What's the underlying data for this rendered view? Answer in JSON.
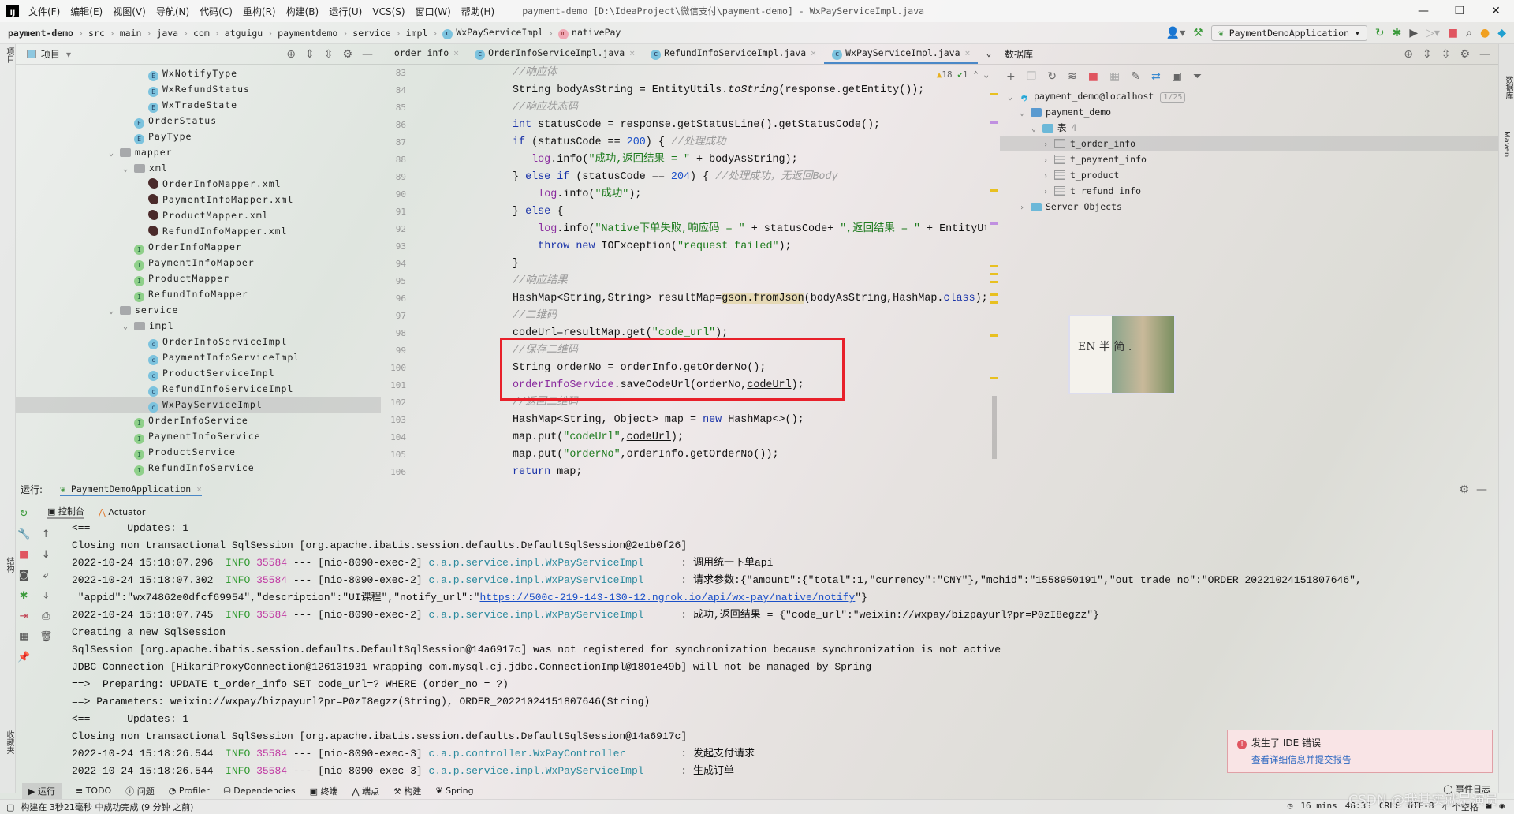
{
  "app": {
    "logo": "IJ",
    "menu": [
      "文件(F)",
      "编辑(E)",
      "视图(V)",
      "导航(N)",
      "代码(C)",
      "重构(R)",
      "构建(B)",
      "运行(U)",
      "VCS(S)",
      "窗口(W)",
      "帮助(H)"
    ],
    "title": "payment-demo [D:\\IdeaProject\\微信支付\\payment-demo] - WxPayServiceImpl.java",
    "window_controls": [
      "—",
      "❐",
      "✕"
    ]
  },
  "breadcrumb": [
    "payment-demo",
    "src",
    "main",
    "java",
    "com",
    "atguigu",
    "paymentdemo",
    "service",
    "impl",
    "WxPayServiceImpl",
    "nativePay"
  ],
  "toolbar": {
    "run_config": "PaymentDemoApplication",
    "icons": [
      "user-icon",
      "build-hammer-icon",
      "rerun-icon",
      "debug-icon",
      "coverage-icon",
      "profile-icon",
      "stop-icon",
      "search-icon",
      "update-icon",
      "jetbrains-icon"
    ]
  },
  "accent": {
    "highlight_box": "#e8202a",
    "stop": "#e05560",
    "link": "#1a4fc8"
  },
  "left_strip": {
    "project": "项目",
    "structure": "结构",
    "favorites": "收藏夹"
  },
  "right_strip": {
    "database": "数据库",
    "maven": "Maven"
  },
  "project": {
    "title": "项目",
    "tree": [
      {
        "label": "WxNotifyType",
        "icon": "E",
        "depth": 4
      },
      {
        "label": "WxRefundStatus",
        "icon": "E",
        "depth": 4
      },
      {
        "label": "WxTradeState",
        "icon": "E",
        "depth": 4
      },
      {
        "label": "OrderStatus",
        "icon": "E",
        "depth": 3
      },
      {
        "label": "PayType",
        "icon": "E",
        "depth": 3
      },
      {
        "label": "mapper",
        "icon": "F",
        "depth": 2,
        "expanded": true
      },
      {
        "label": "xml",
        "icon": "F",
        "depth": 3,
        "expanded": true
      },
      {
        "label": "OrderInfoMapper.xml",
        "icon": "X",
        "depth": 4
      },
      {
        "label": "PaymentInfoMapper.xml",
        "icon": "X",
        "depth": 4
      },
      {
        "label": "ProductMapper.xml",
        "icon": "X",
        "depth": 4
      },
      {
        "label": "RefundInfoMapper.xml",
        "icon": "X",
        "depth": 4
      },
      {
        "label": "OrderInfoMapper",
        "icon": "I",
        "depth": 3
      },
      {
        "label": "PaymentInfoMapper",
        "icon": "I",
        "depth": 3
      },
      {
        "label": "ProductMapper",
        "icon": "I",
        "depth": 3
      },
      {
        "label": "RefundInfoMapper",
        "icon": "I",
        "depth": 3
      },
      {
        "label": "service",
        "icon": "F",
        "depth": 2,
        "expanded": true
      },
      {
        "label": "impl",
        "icon": "F",
        "depth": 3,
        "expanded": true
      },
      {
        "label": "OrderInfoServiceImpl",
        "icon": "C",
        "depth": 4
      },
      {
        "label": "PaymentInfoServiceImpl",
        "icon": "C",
        "depth": 4
      },
      {
        "label": "ProductServiceImpl",
        "icon": "C",
        "depth": 4
      },
      {
        "label": "RefundInfoServiceImpl",
        "icon": "C",
        "depth": 4
      },
      {
        "label": "WxPayServiceImpl",
        "icon": "C",
        "depth": 4,
        "selected": true
      },
      {
        "label": "OrderInfoService",
        "icon": "I",
        "depth": 3
      },
      {
        "label": "PaymentInfoService",
        "icon": "I",
        "depth": 3
      },
      {
        "label": "ProductService",
        "icon": "I",
        "depth": 3
      },
      {
        "label": "RefundInfoService",
        "icon": "I",
        "depth": 3
      }
    ]
  },
  "editor": {
    "tabs": [
      {
        "label": "_order_info",
        "icon": ""
      },
      {
        "label": "OrderInfoServiceImpl.java",
        "icon": "C"
      },
      {
        "label": "RefundInfoServiceImpl.java",
        "icon": "C"
      },
      {
        "label": "WxPayServiceImpl.java",
        "icon": "C",
        "active": true
      }
    ],
    "inspections": {
      "warnings": "18",
      "ok": "1"
    },
    "lines": [
      {
        "n": "83",
        "t": [
          [
            "//响应体",
            "c"
          ]
        ]
      },
      {
        "n": "84",
        "t": [
          [
            "String bodyAsString = EntityUtils.",
            ""
          ],
          [
            "toString",
            "m"
          ],
          [
            "(response.getEntity());",
            ""
          ]
        ]
      },
      {
        "n": "85",
        "t": [
          [
            "//响应状态码",
            "c"
          ]
        ]
      },
      {
        "n": "86",
        "t": [
          [
            "int",
            "k"
          ],
          [
            " statusCode = response.getStatusLine().getStatusCode();",
            ""
          ]
        ]
      },
      {
        "n": "87",
        "t": [
          [
            "if",
            "k"
          ],
          [
            " (statusCode == ",
            ""
          ],
          [
            "200",
            "n"
          ],
          [
            ") { ",
            ""
          ],
          [
            "//处理成功",
            "c"
          ]
        ]
      },
      {
        "n": "88",
        "t": [
          [
            "   ",
            ""
          ],
          [
            "log",
            "f"
          ],
          [
            ".info(",
            ""
          ],
          [
            "\"成功,返回结果 = \"",
            "s"
          ],
          [
            " + bodyAsString);",
            ""
          ]
        ]
      },
      {
        "n": "89",
        "t": [
          [
            "} ",
            ""
          ],
          [
            "else if",
            "k"
          ],
          [
            " (statusCode == ",
            ""
          ],
          [
            "204",
            "n"
          ],
          [
            ") { ",
            ""
          ],
          [
            "//处理成功，无返回Body",
            "c"
          ]
        ]
      },
      {
        "n": "90",
        "t": [
          [
            "    ",
            ""
          ],
          [
            "log",
            "f"
          ],
          [
            ".info(",
            ""
          ],
          [
            "\"成功\"",
            "s"
          ],
          [
            ");",
            ""
          ]
        ]
      },
      {
        "n": "91",
        "t": [
          [
            "} ",
            ""
          ],
          [
            "else",
            "k"
          ],
          [
            " {",
            ""
          ]
        ]
      },
      {
        "n": "92",
        "t": [
          [
            "    ",
            ""
          ],
          [
            "log",
            "f"
          ],
          [
            ".info(",
            ""
          ],
          [
            "\"Native下单失败,响应码 = \"",
            "s"
          ],
          [
            " + statusCode+ ",
            ""
          ],
          [
            "\",返回结果 = \"",
            "s"
          ],
          [
            " + EntityUtil",
            ""
          ]
        ]
      },
      {
        "n": "93",
        "t": [
          [
            "    ",
            ""
          ],
          [
            "throw new",
            "k"
          ],
          [
            " IOException(",
            ""
          ],
          [
            "\"request failed\"",
            "s"
          ],
          [
            ");",
            ""
          ]
        ]
      },
      {
        "n": "94",
        "t": [
          [
            "}",
            ""
          ]
        ]
      },
      {
        "n": "95",
        "t": [
          [
            "//响应结果",
            "c"
          ]
        ]
      },
      {
        "n": "96",
        "t": [
          [
            "HashMap<String,String> resultMap=",
            ""
          ],
          [
            "gson.fromJson",
            "h"
          ],
          [
            "(bodyAsString,HashMap.",
            ""
          ],
          [
            "class",
            "k"
          ],
          [
            ");",
            ""
          ]
        ]
      },
      {
        "n": "97",
        "t": [
          [
            "//二维码",
            "c"
          ]
        ]
      },
      {
        "n": "98",
        "t": [
          [
            "codeUrl=resultMap.get(",
            ""
          ],
          [
            "\"code_url\"",
            "s"
          ],
          [
            ");",
            ""
          ]
        ]
      },
      {
        "n": "99",
        "t": [
          [
            "//保存二维码",
            "c"
          ]
        ]
      },
      {
        "n": "100",
        "t": [
          [
            "String orderNo = orderInfo.getOrderNo();",
            ""
          ]
        ]
      },
      {
        "n": "101",
        "t": [
          [
            "orderInfoService",
            "f"
          ],
          [
            ".saveCodeUrl(orderNo,",
            ""
          ],
          [
            "codeUrl",
            "u"
          ],
          [
            ");",
            ""
          ]
        ]
      },
      {
        "n": "102",
        "t": [
          [
            "//返回二维码",
            "c"
          ]
        ]
      },
      {
        "n": "103",
        "t": [
          [
            "HashMap<String, Object> map = ",
            ""
          ],
          [
            "new",
            "k"
          ],
          [
            " HashMap<>();",
            ""
          ]
        ]
      },
      {
        "n": "104",
        "t": [
          [
            "map.put(",
            ""
          ],
          [
            "\"codeUrl\"",
            "s"
          ],
          [
            ",",
            ""
          ],
          [
            "codeUrl",
            "u"
          ],
          [
            ");",
            ""
          ]
        ]
      },
      {
        "n": "105",
        "t": [
          [
            "map.put(",
            ""
          ],
          [
            "\"orderNo\"",
            "s"
          ],
          [
            ",orderInfo.getOrderNo());",
            ""
          ]
        ]
      },
      {
        "n": "106",
        "t": [
          [
            "return",
            "k"
          ],
          [
            " map;",
            ""
          ]
        ]
      }
    ]
  },
  "database": {
    "title": "数据库",
    "tree": [
      {
        "label": "payment_demo@localhost",
        "badge": "1/25",
        "depth": 0,
        "icon": "datasource",
        "chev": "v"
      },
      {
        "label": "payment_demo",
        "depth": 1,
        "icon": "schema",
        "chev": "v"
      },
      {
        "label": "表",
        "count": "4",
        "depth": 2,
        "icon": "folder",
        "chev": "v"
      },
      {
        "label": "t_order_info",
        "depth": 3,
        "icon": "table",
        "chev": ">",
        "selected": true
      },
      {
        "label": "t_payment_info",
        "depth": 3,
        "icon": "table",
        "chev": ">"
      },
      {
        "label": "t_product",
        "depth": 3,
        "icon": "table",
        "chev": ">"
      },
      {
        "label": "t_refund_info",
        "depth": 3,
        "icon": "table",
        "chev": ">"
      },
      {
        "label": "Server Objects",
        "depth": 1,
        "icon": "folder",
        "chev": ">"
      }
    ]
  },
  "overlay_image": {
    "text": "EN 半 简 ."
  },
  "run": {
    "label": "运行:",
    "config": "PaymentDemoApplication",
    "tabs": [
      "控制台",
      "Actuator"
    ],
    "console": [
      [
        [
          "<==      Updates: 1",
          ""
        ]
      ],
      [
        [
          "Closing non transactional SqlSession [org.apache.ibatis.session.defaults.DefaultSqlSession@2e1b0f26]",
          ""
        ]
      ],
      [
        [
          "2022-10-24 15:18:07.296  ",
          ""
        ],
        [
          "INFO",
          "lv"
        ],
        [
          " ",
          ""
        ],
        [
          "35584",
          "pid"
        ],
        [
          " --- [nio-8090-exec-2] ",
          ""
        ],
        [
          "c.a.p.service.impl.WxPayServiceImpl",
          "lg"
        ],
        [
          "      : 调用统一下单api",
          ""
        ]
      ],
      [
        [
          "2022-10-24 15:18:07.302  ",
          ""
        ],
        [
          "INFO",
          "lv"
        ],
        [
          " ",
          ""
        ],
        [
          "35584",
          "pid"
        ],
        [
          " --- [nio-8090-exec-2] ",
          ""
        ],
        [
          "c.a.p.service.impl.WxPayServiceImpl",
          "lg"
        ],
        [
          "      : 请求参数:{\"amount\":{\"total\":1,\"currency\":\"CNY\"},\"mchid\":\"1558950191\",\"out_trade_no\":\"ORDER_20221024151807646\",",
          ""
        ]
      ],
      [
        [
          " \"appid\":\"wx74862e0dfcf69954\",\"description\":\"UI课程\",\"notify_url\":\"",
          ""
        ],
        [
          "https://500c-219-143-130-12.ngrok.io/api/wx-pay/native/notify",
          "lnk"
        ],
        [
          "\"}",
          ""
        ]
      ],
      [
        [
          "2022-10-24 15:18:07.745  ",
          ""
        ],
        [
          "INFO",
          "lv"
        ],
        [
          " ",
          ""
        ],
        [
          "35584",
          "pid"
        ],
        [
          " --- [nio-8090-exec-2] ",
          ""
        ],
        [
          "c.a.p.service.impl.WxPayServiceImpl",
          "lg"
        ],
        [
          "      : 成功,返回结果 = {\"code_url\":\"weixin://wxpay/bizpayurl?pr=P0zI8egzz\"}",
          ""
        ]
      ],
      [
        [
          "Creating a new SqlSession",
          ""
        ]
      ],
      [
        [
          "SqlSession [org.apache.ibatis.session.defaults.DefaultSqlSession@14a6917c] was not registered for synchronization because synchronization is not active",
          ""
        ]
      ],
      [
        [
          "JDBC Connection [HikariProxyConnection@126131931 wrapping com.mysql.cj.jdbc.ConnectionImpl@1801e49b] will not be managed by Spring",
          ""
        ]
      ],
      [
        [
          "==>  Preparing: UPDATE t_order_info SET code_url=? WHERE (order_no = ?)",
          ""
        ]
      ],
      [
        [
          "==> Parameters: weixin://wxpay/bizpayurl?pr=P0zI8egzz(String), ORDER_20221024151807646(String)",
          ""
        ]
      ],
      [
        [
          "<==      Updates: 1",
          ""
        ]
      ],
      [
        [
          "Closing non transactional SqlSession [org.apache.ibatis.session.defaults.DefaultSqlSession@14a6917c]",
          ""
        ]
      ],
      [
        [
          "2022-10-24 15:18:26.544  ",
          ""
        ],
        [
          "INFO",
          "lv"
        ],
        [
          " ",
          ""
        ],
        [
          "35584",
          "pid"
        ],
        [
          " --- [nio-8090-exec-3] ",
          ""
        ],
        [
          "c.a.p.controller.WxPayController",
          "lg"
        ],
        [
          "         : 发起支付请求",
          ""
        ]
      ],
      [
        [
          "2022-10-24 15:18:26.544  ",
          ""
        ],
        [
          "INFO",
          "lv"
        ],
        [
          " ",
          ""
        ],
        [
          "35584",
          "pid"
        ],
        [
          " --- [nio-8090-exec-3] ",
          ""
        ],
        [
          "c.a.p.service.impl.WxPayServiceImpl",
          "lg"
        ],
        [
          "      : 生成订单",
          ""
        ]
      ]
    ]
  },
  "bottom_tabs": [
    "运行",
    "TODO",
    "问题",
    "Profiler",
    "Dependencies",
    "终端",
    "端点",
    "构建",
    "Spring"
  ],
  "event_log": "事件日志",
  "status": {
    "message": "构建在 3秒21毫秒 中成功完成 (9 分钟 之前)",
    "time": "16 mins",
    "position": "48:33",
    "line_sep": "CRLF",
    "encoding": "UTF-8",
    "indent": "4 个空格"
  },
  "notification": {
    "title": "发生了 IDE 错误",
    "link": "查看详细信息并提交报告"
  },
  "watermark": "CSDN @我其实就是演员"
}
